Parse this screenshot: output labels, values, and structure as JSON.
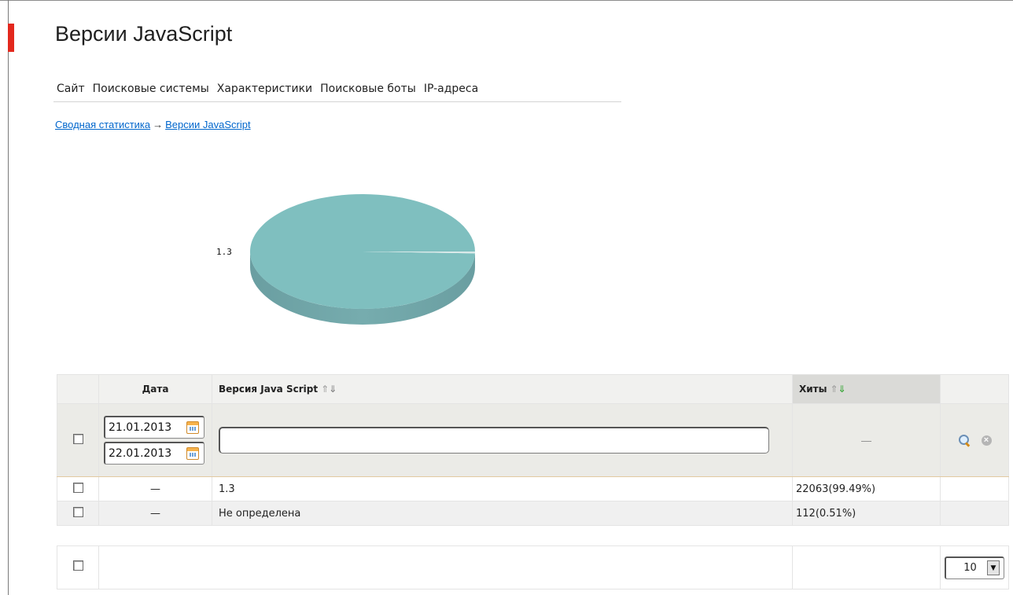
{
  "page": {
    "title": "Версии JavaScript"
  },
  "tabs": [
    "Сайт",
    "Поисковые системы",
    "Характеристики",
    "Поисковые боты",
    "IP-адреса"
  ],
  "breadcrumb": {
    "root": "Сводная статистика",
    "arrow": "→",
    "current": "Версии JavaScript"
  },
  "chart_data": {
    "type": "pie",
    "labels": [
      "1.3",
      "Не определена"
    ],
    "values": [
      99.49,
      0.51
    ],
    "slice_labels": [
      "1.3"
    ],
    "colors": [
      "#7fbfbf",
      "#d9e9e9"
    ]
  },
  "table": {
    "headers": {
      "date": "Дата",
      "version": "Версия Java Script",
      "hits": "Хиты",
      "sort_up": "⇑",
      "sort_down": "⇓"
    },
    "filter": {
      "date_from": "21.01.2013",
      "date_to": "22.01.2013",
      "version_value": "",
      "hits_placeholder": "—",
      "clear_symbol": "×"
    },
    "rows": [
      {
        "date": "—",
        "version": "1.3",
        "hits": "22063(99.49%)"
      },
      {
        "date": "—",
        "version": "Не определена",
        "hits": "112(0.51%)"
      }
    ]
  },
  "footer": {
    "page_size": "10",
    "dropdown_glyph": "▼"
  },
  "icons": {
    "calendar": "calendar-icon",
    "search": "search-icon",
    "clear": "clear-icon"
  }
}
